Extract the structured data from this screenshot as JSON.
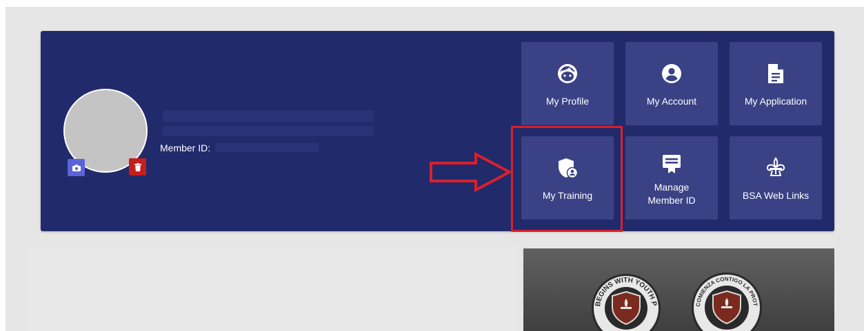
{
  "profile": {
    "member_id_label": "Member ID:"
  },
  "tiles": [
    {
      "label": "My Profile",
      "icon": "face-icon"
    },
    {
      "label": "My Account",
      "icon": "account-circle-icon"
    },
    {
      "label": "My Application",
      "icon": "document-icon"
    },
    {
      "label": "My Training",
      "icon": "shield-user-icon"
    },
    {
      "label": "Manage Member ID",
      "icon": "id-card-icon"
    },
    {
      "label": "BSA Web Links",
      "icon": "fleur-de-lis-icon"
    }
  ],
  "promo": {
    "badge1_text": "BEGINS WITH YOUTH PROTECTION",
    "badge2_text": "COMIENZA CONTIGO LA PROTECCIÓN DE MENORES"
  },
  "colors": {
    "hero_bg": "#212a6b",
    "tile_bg": "#3a4285",
    "highlight": "#d9202a",
    "camera_btn": "#5a63d9",
    "delete_btn": "#c41e1e"
  }
}
